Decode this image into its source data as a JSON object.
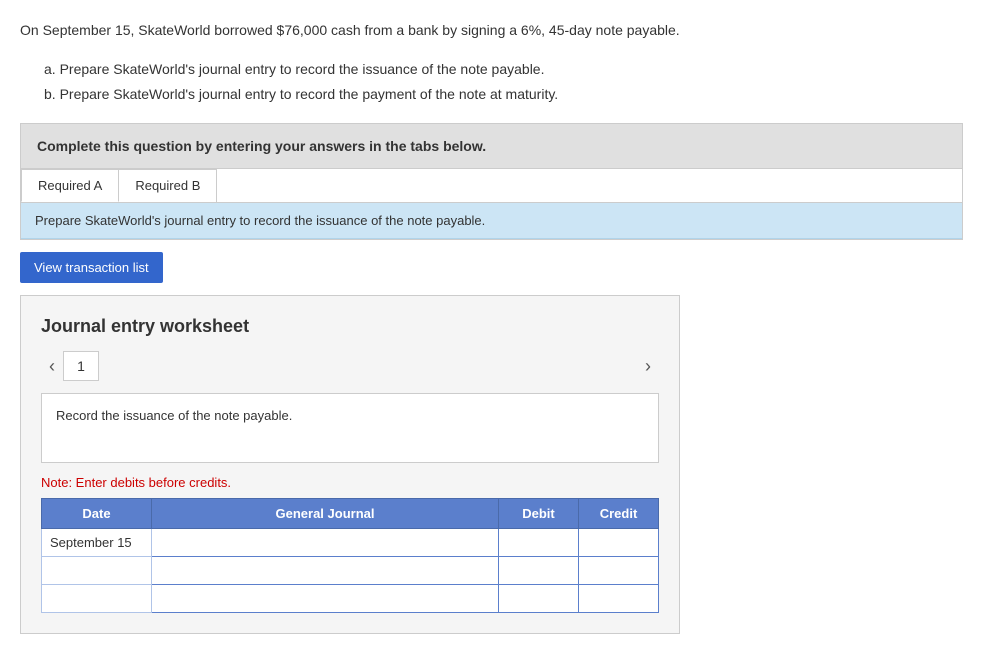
{
  "intro": {
    "main_text": "On September 15, SkateWorld borrowed $76,000 cash from a bank by signing a 6%, 45-day note payable.",
    "point_a": "a. Prepare SkateWorld's journal entry to record the issuance of the note payable.",
    "point_b": "b. Prepare SkateWorld's journal entry to record the payment of the note at maturity."
  },
  "instruction_box": {
    "text": "Complete this question by entering your answers in the tabs below."
  },
  "tabs": [
    {
      "label": "Required A",
      "active": true
    },
    {
      "label": "Required B",
      "active": false
    }
  ],
  "blue_bar": {
    "text": "Prepare SkateWorld's journal entry to record the issuance of the note payable."
  },
  "view_transaction_btn": "View transaction list",
  "worksheet": {
    "title": "Journal entry worksheet",
    "nav_number": "1",
    "record_text": "Record the issuance of the note payable.",
    "note": "Note: Enter debits before credits.",
    "table": {
      "headers": [
        "Date",
        "General Journal",
        "Debit",
        "Credit"
      ],
      "rows": [
        {
          "date": "September 15",
          "journal": "",
          "debit": "",
          "credit": ""
        },
        {
          "date": "",
          "journal": "",
          "debit": "",
          "credit": ""
        },
        {
          "date": "",
          "journal": "",
          "debit": "",
          "credit": ""
        }
      ]
    }
  },
  "icons": {
    "left_arrow": "‹",
    "right_arrow": "›"
  }
}
